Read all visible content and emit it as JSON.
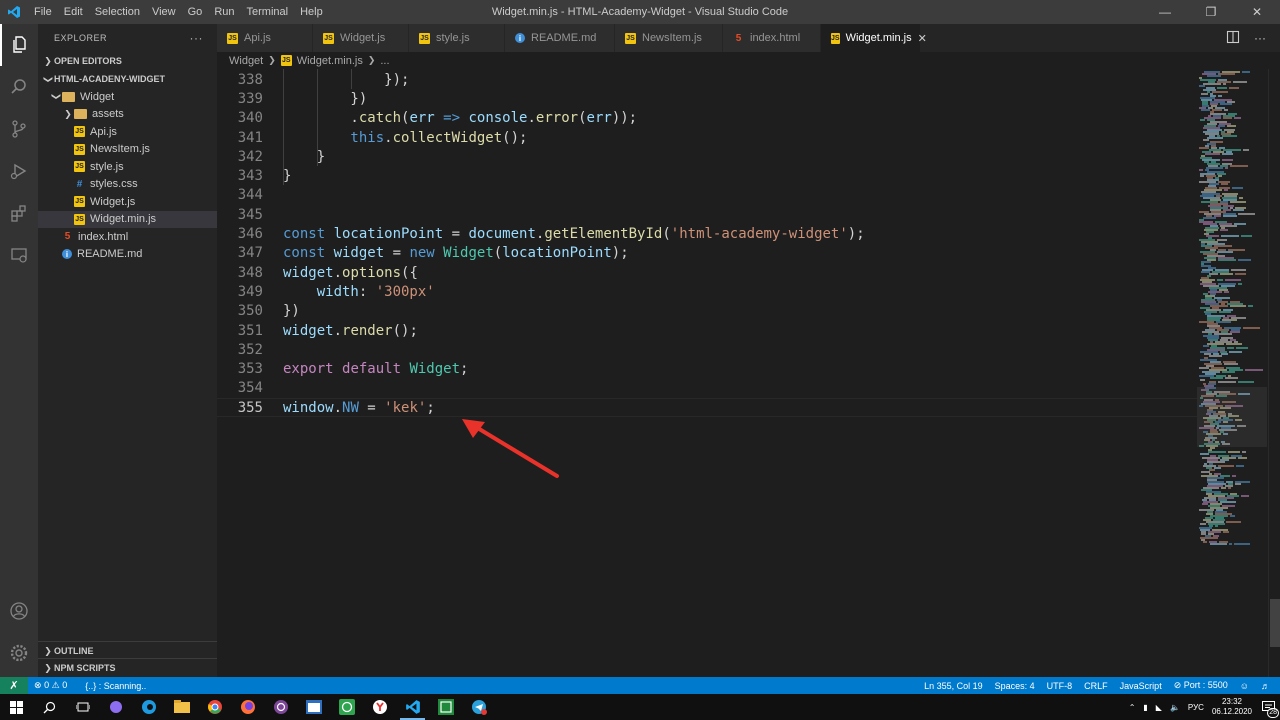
{
  "window": {
    "title": "Widget.min.js - HTML-Academy-Widget - Visual Studio Code",
    "menu": [
      "File",
      "Edit",
      "Selection",
      "View",
      "Go",
      "Run",
      "Terminal",
      "Help"
    ]
  },
  "sidebar": {
    "header": "EXPLORER",
    "more": "···",
    "open_editors": "OPEN EDITORS",
    "project": "HTML-ACADENY-WIDGET",
    "tree": [
      {
        "label": "Widget",
        "type": "folder",
        "depth": 1,
        "expanded": true
      },
      {
        "label": "assets",
        "type": "folder",
        "depth": 2,
        "expanded": false
      },
      {
        "label": "Api.js",
        "type": "js",
        "depth": 2
      },
      {
        "label": "NewsItem.js",
        "type": "js",
        "depth": 2
      },
      {
        "label": "style.js",
        "type": "js",
        "depth": 2
      },
      {
        "label": "styles.css",
        "type": "css",
        "depth": 2
      },
      {
        "label": "Widget.js",
        "type": "js",
        "depth": 2
      },
      {
        "label": "Widget.min.js",
        "type": "js",
        "depth": 2,
        "selected": true
      },
      {
        "label": "index.html",
        "type": "html",
        "depth": 1
      },
      {
        "label": "README.md",
        "type": "info",
        "depth": 1
      }
    ],
    "outline": "OUTLINE",
    "npm_scripts": "NPM SCRIPTS"
  },
  "tabs": [
    {
      "label": "Api.js",
      "type": "js"
    },
    {
      "label": "Widget.js",
      "type": "js"
    },
    {
      "label": "style.js",
      "type": "js"
    },
    {
      "label": "README.md",
      "type": "info"
    },
    {
      "label": "NewsItem.js",
      "type": "js"
    },
    {
      "label": "index.html",
      "type": "html"
    },
    {
      "label": "Widget.min.js",
      "type": "js",
      "active": true
    }
  ],
  "breadcrumb": {
    "folder": "Widget",
    "file": "Widget.min.js",
    "more": "..."
  },
  "editor": {
    "current_line": 355,
    "lines": [
      {
        "n": "338",
        "tokens": [
          [
            "pun",
            "            });"
          ]
        ]
      },
      {
        "n": "339",
        "tokens": [
          [
            "pun",
            "        })"
          ]
        ]
      },
      {
        "n": "340",
        "tokens": [
          [
            "pun",
            "        ."
          ],
          [
            "fn",
            "catch"
          ],
          [
            "pun",
            "("
          ],
          [
            "var",
            "err"
          ],
          [
            "kw2",
            " => "
          ],
          [
            "var",
            "console"
          ],
          [
            "pun",
            "."
          ],
          [
            "fn",
            "error"
          ],
          [
            "pun",
            "("
          ],
          [
            "var",
            "err"
          ],
          [
            "pun",
            "));"
          ]
        ]
      },
      {
        "n": "341",
        "tokens": [
          [
            "kw2",
            "        this"
          ],
          [
            "pun",
            "."
          ],
          [
            "fn",
            "collectWidget"
          ],
          [
            "pun",
            "();"
          ]
        ]
      },
      {
        "n": "342",
        "tokens": [
          [
            "pun",
            "    }"
          ]
        ]
      },
      {
        "n": "343",
        "tokens": [
          [
            "pun",
            "}"
          ]
        ]
      },
      {
        "n": "344",
        "tokens": []
      },
      {
        "n": "345",
        "tokens": []
      },
      {
        "n": "346",
        "tokens": [
          [
            "kw2",
            "const "
          ],
          [
            "var",
            "locationPoint"
          ],
          [
            "pun",
            " = "
          ],
          [
            "var",
            "document"
          ],
          [
            "pun",
            "."
          ],
          [
            "fn",
            "getElementById"
          ],
          [
            "pun",
            "("
          ],
          [
            "str",
            "'html-academy-widget'"
          ],
          [
            "pun",
            ");"
          ]
        ]
      },
      {
        "n": "347",
        "tokens": [
          [
            "kw2",
            "const "
          ],
          [
            "var",
            "widget"
          ],
          [
            "pun",
            " = "
          ],
          [
            "kw2",
            "new "
          ],
          [
            "cls",
            "Widget"
          ],
          [
            "pun",
            "("
          ],
          [
            "var",
            "locationPoint"
          ],
          [
            "pun",
            ");"
          ]
        ]
      },
      {
        "n": "348",
        "tokens": [
          [
            "var",
            "widget"
          ],
          [
            "pun",
            "."
          ],
          [
            "fn",
            "options"
          ],
          [
            "pun",
            "({"
          ]
        ]
      },
      {
        "n": "349",
        "tokens": [
          [
            "var",
            "    width"
          ],
          [
            "pun",
            ": "
          ],
          [
            "str",
            "'300px'"
          ]
        ]
      },
      {
        "n": "350",
        "tokens": [
          [
            "pun",
            "})"
          ]
        ]
      },
      {
        "n": "351",
        "tokens": [
          [
            "var",
            "widget"
          ],
          [
            "pun",
            "."
          ],
          [
            "fn",
            "render"
          ],
          [
            "pun",
            "();"
          ]
        ]
      },
      {
        "n": "352",
        "tokens": []
      },
      {
        "n": "353",
        "tokens": [
          [
            "kw",
            "export "
          ],
          [
            "kw",
            "default "
          ],
          [
            "cls",
            "Widget"
          ],
          [
            "pun",
            ";"
          ]
        ]
      },
      {
        "n": "354",
        "tokens": []
      },
      {
        "n": "355",
        "tokens": [
          [
            "var",
            "window"
          ],
          [
            "pun",
            "."
          ],
          [
            "kw2",
            "NW"
          ],
          [
            "pun",
            " = "
          ],
          [
            "str",
            "'kek'"
          ],
          [
            "pun",
            ";"
          ]
        ]
      }
    ]
  },
  "statusbar": {
    "errors": "0",
    "warnings": "0",
    "scanning": "{..} : Scanning..",
    "position": "Ln 355, Col 19",
    "spaces": "Spaces: 4",
    "encoding": "UTF-8",
    "eol": "CRLF",
    "language": "JavaScript",
    "port": "Port : 5500"
  },
  "taskbar": {
    "lang": "РУС",
    "time": "23:32",
    "date": "06.12.2020",
    "notifications": "28"
  },
  "colors": {
    "accent": "#007acc",
    "annotation_arrow": "#e8322a"
  }
}
